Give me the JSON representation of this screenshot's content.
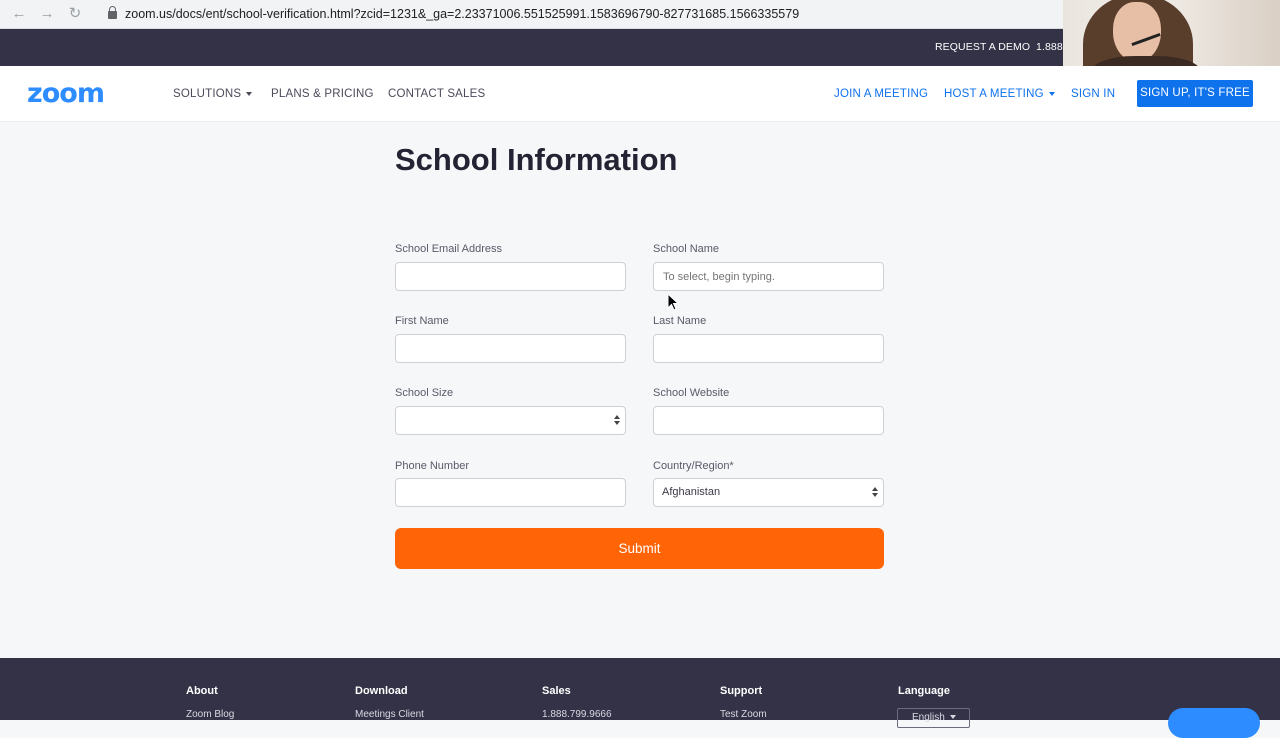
{
  "browser": {
    "url": "zoom.us/docs/ent/school-verification.html?zcid=1231&_ga=2.23371006.551525991.1583696790-827731685.1566335579"
  },
  "top_strip": {
    "request_demo": "REQUEST A DEMO",
    "phone_partial": "1.888."
  },
  "header": {
    "logo": "zoom",
    "menu_left": [
      "SOLUTIONS",
      "PLANS & PRICING",
      "CONTACT SALES"
    ],
    "join_meeting": "JOIN A MEETING",
    "host_meeting": "HOST A MEETING",
    "sign_in": "SIGN IN",
    "sign_up": "SIGN UP, IT'S FREE",
    "accent_color": "#0e72ed"
  },
  "form": {
    "title": "School Information",
    "fields": {
      "school_email": {
        "label": "School Email Address",
        "value": "",
        "placeholder": ""
      },
      "school_name": {
        "label": "School Name",
        "value": "",
        "placeholder": "To select, begin typing."
      },
      "first_name": {
        "label": "First Name",
        "value": "",
        "placeholder": ""
      },
      "last_name": {
        "label": "Last Name",
        "value": "",
        "placeholder": ""
      },
      "school_size": {
        "label": "School Size",
        "selected": ""
      },
      "school_website": {
        "label": "School Website",
        "value": "",
        "placeholder": ""
      },
      "phone_number": {
        "label": "Phone Number",
        "value": "",
        "placeholder": ""
      },
      "country_region": {
        "label": "Country/Region*",
        "selected": "Afghanistan"
      }
    },
    "submit_label": "Submit",
    "submit_color": "#ff6406"
  },
  "footer": {
    "columns": [
      {
        "heading": "About",
        "first_link": "Zoom Blog"
      },
      {
        "heading": "Download",
        "first_link": "Meetings Client"
      },
      {
        "heading": "Sales",
        "first_link": "1.888.799.9666"
      },
      {
        "heading": "Support",
        "first_link": "Test Zoom"
      },
      {
        "heading": "Language",
        "first_link": "English"
      }
    ]
  }
}
